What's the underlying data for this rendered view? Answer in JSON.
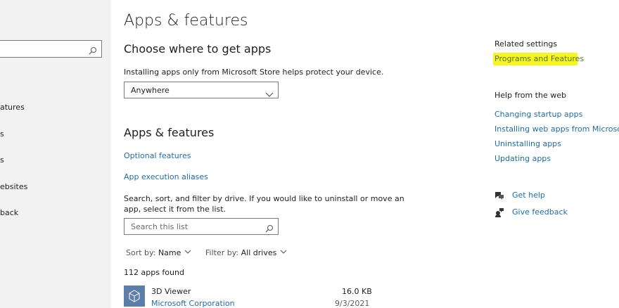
{
  "sidebar": {
    "search_placeholder": "",
    "items": [
      "atures",
      "s",
      "s",
      "ebsites",
      "back"
    ]
  },
  "main": {
    "title": "Apps & features",
    "choose": {
      "heading": "Choose where to get apps",
      "description": "Installing apps only from Microsoft Store helps protect your device.",
      "dropdown_value": "Anywhere"
    },
    "apps": {
      "heading": "Apps & features",
      "optional_features": "Optional features",
      "execution_aliases": "App execution aliases",
      "instructions_line1": "Search, sort, and filter by drive. If you would like to uninstall or move an",
      "instructions_line2": "app, select it from the list.",
      "search_placeholder": "Search this list",
      "sort_label": "Sort by:",
      "sort_value": "Name",
      "filter_label": "Filter by:",
      "filter_value": "All drives",
      "count": "112 apps found",
      "list": [
        {
          "name": "3D Viewer",
          "publisher": "Microsoft Corporation",
          "size": "16.0 KB",
          "date": "9/3/2021"
        }
      ]
    }
  },
  "right": {
    "related_title": "Related settings",
    "programs_link": "Programs and Features",
    "help_title": "Help from the web",
    "help_links": [
      "Changing startup apps",
      "Installing web apps from Microsoft",
      "Uninstalling apps",
      "Updating apps"
    ],
    "get_help": "Get help",
    "give_feedback": "Give feedback"
  },
  "colors": {
    "link": "#1e6ca8",
    "highlight": "#f6f71f",
    "app_tile": "#5c7ea8"
  }
}
